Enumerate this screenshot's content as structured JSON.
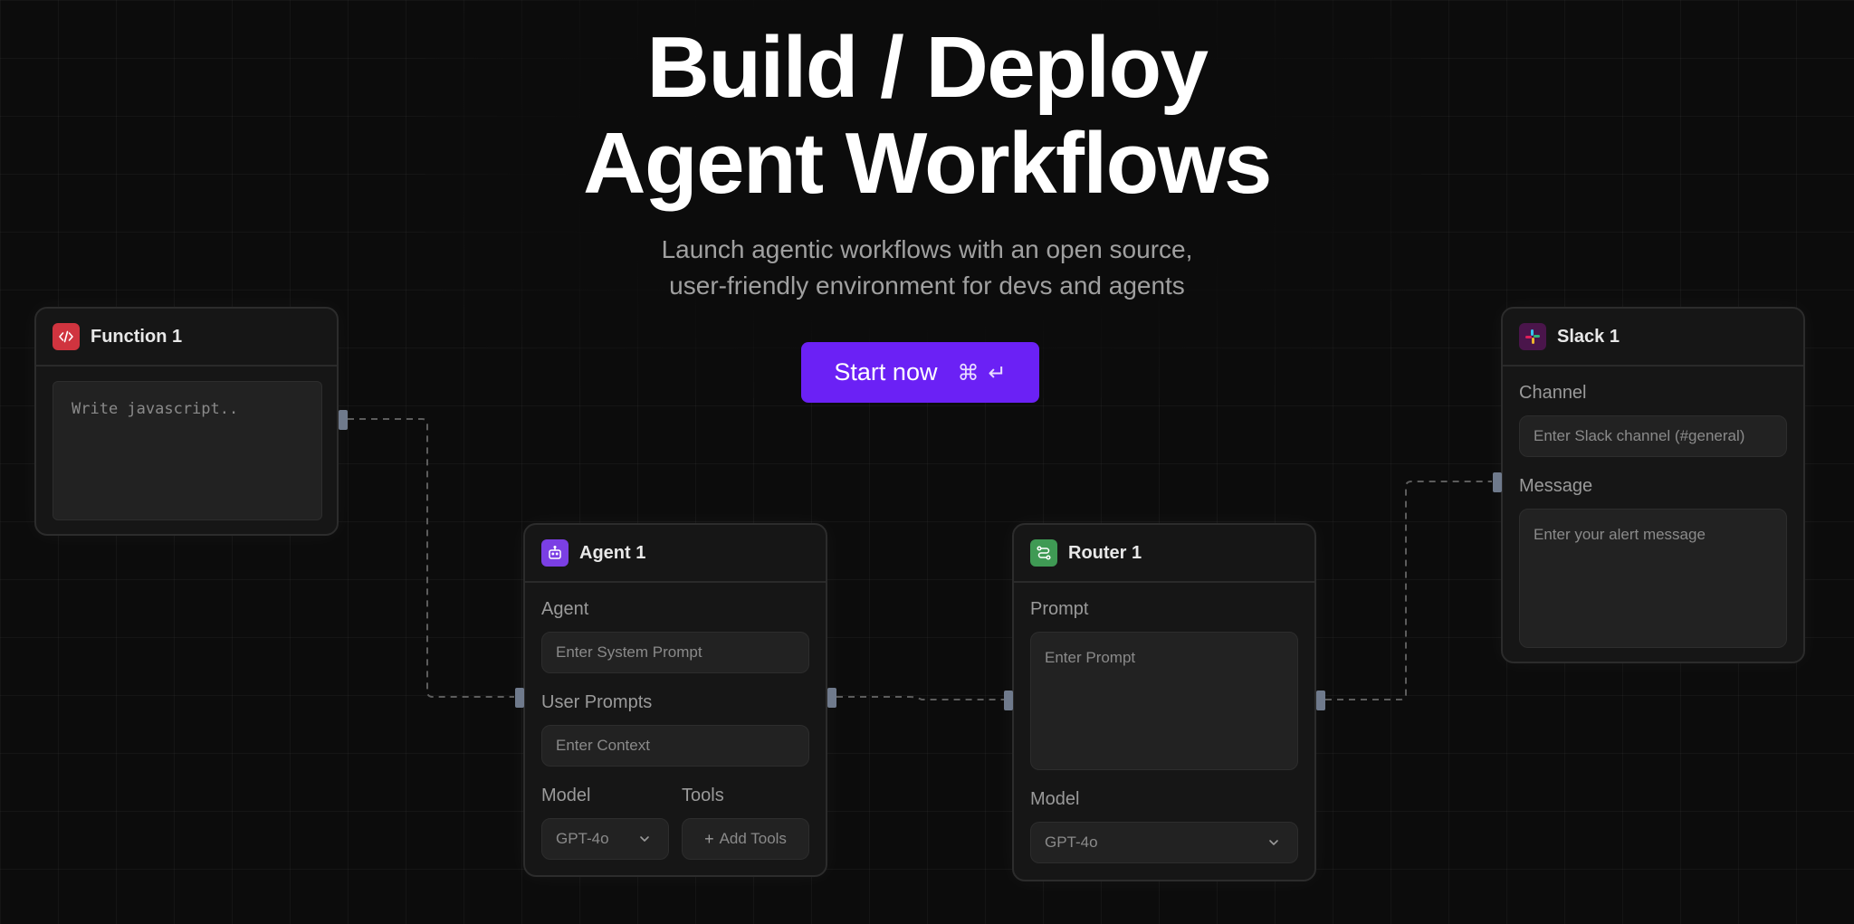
{
  "hero": {
    "title_line1": "Build / Deploy",
    "title_line2": "Agent Workflows",
    "subtitle_line1": "Launch agentic workflows with an open source,",
    "subtitle_line2": "user-friendly environment for devs and agents",
    "cta_label": "Start now",
    "cta_shortcut_cmd": "⌘",
    "cta_shortcut_enter": "↵"
  },
  "function_node": {
    "title": "Function 1",
    "icon": "code-icon",
    "accent": "#d0343f",
    "code_placeholder": "Write javascript.."
  },
  "agent_node": {
    "title": "Agent 1",
    "icon": "robot-icon",
    "accent": "#7b3fe4",
    "agent_label": "Agent",
    "agent_placeholder": "Enter System Prompt",
    "user_prompts_label": "User Prompts",
    "user_prompts_placeholder": "Enter Context",
    "model_label": "Model",
    "model_value": "GPT-4o",
    "tools_label": "Tools",
    "add_tools_label": "Add Tools"
  },
  "router_node": {
    "title": "Router 1",
    "icon": "route-icon",
    "accent": "#3f9a54",
    "prompt_label": "Prompt",
    "prompt_placeholder": "Enter Prompt",
    "model_label": "Model",
    "model_value": "GPT-4o"
  },
  "slack_node": {
    "title": "Slack 1",
    "icon": "slack-icon",
    "accent": "#4a154b",
    "channel_label": "Channel",
    "channel_placeholder": "Enter Slack channel (#general)",
    "message_label": "Message",
    "message_placeholder": "Enter your alert message"
  }
}
